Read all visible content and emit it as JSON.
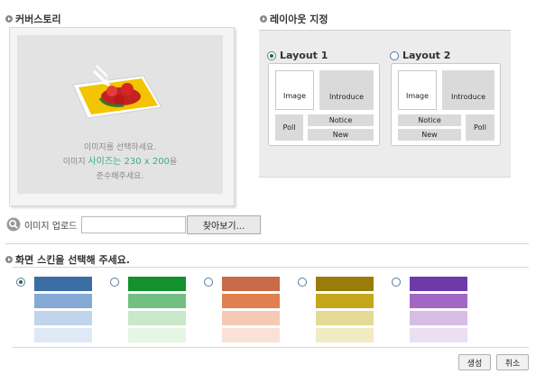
{
  "sections": {
    "canvas_story": "커버스토리",
    "layout_setting": "레이아웃 지정",
    "skin_select": "화면 스킨을 선택해 주세요."
  },
  "canvas": {
    "hint_line1": "이미지를 선택하세요.",
    "hint_line2_prefix": "이미지 ",
    "hint_line2_highlight": "사이즈는 230 x 200",
    "hint_line2_suffix": "을",
    "hint_line3": "준수해주세요."
  },
  "layouts": [
    {
      "label": "Layout 1",
      "selected": true,
      "image": "Image",
      "introduce": "Introduce",
      "poll": "Poll",
      "notice": "Notice",
      "new": "New"
    },
    {
      "label": "Layout 2",
      "selected": false,
      "image": "Image",
      "introduce": "Introduce",
      "poll": "Poll",
      "notice": "Notice",
      "new": "New"
    }
  ],
  "upload": {
    "label": "이미지 업로드",
    "input_value": "",
    "browse_button": "찾아보기..."
  },
  "skins": [
    {
      "selected": true,
      "colors": [
        "#3a6ea5",
        "#86a9d6",
        "#c0d4ec",
        "#dfe9f6"
      ]
    },
    {
      "selected": false,
      "colors": [
        "#14902d",
        "#72bf82",
        "#c8e8c9",
        "#e6f6e4"
      ]
    },
    {
      "selected": false,
      "colors": [
        "#c96a49",
        "#e08050",
        "#f6c9b5",
        "#fae1d6"
      ]
    },
    {
      "selected": false,
      "colors": [
        "#9a7c0a",
        "#c4a71a",
        "#e5d996",
        "#f1ebc4"
      ]
    },
    {
      "selected": false,
      "colors": [
        "#6e3aaa",
        "#a068c4",
        "#d6bce6",
        "#ebdff3"
      ]
    }
  ],
  "actions": {
    "create": "생성",
    "cancel": "취소"
  }
}
